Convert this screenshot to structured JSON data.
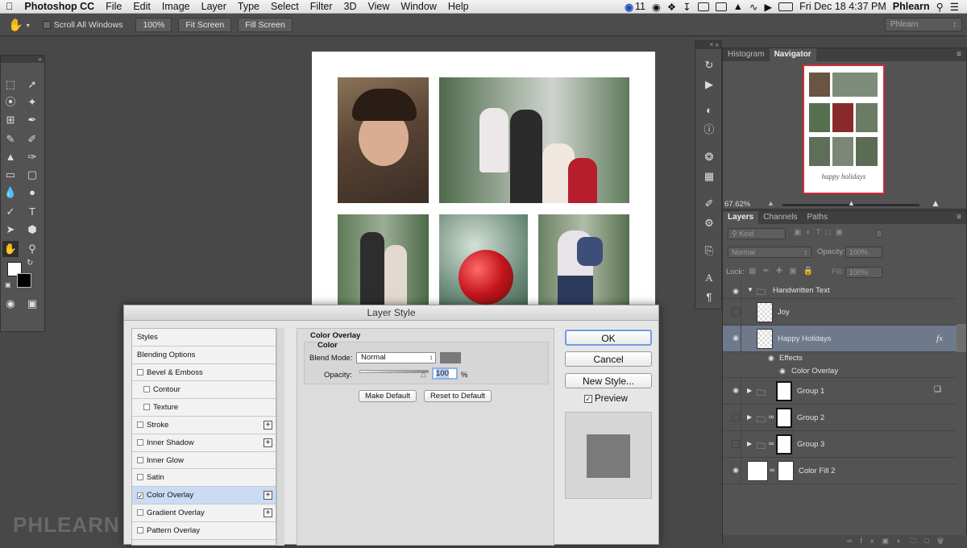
{
  "menubar": {
    "apple": "",
    "app": "Photoshop CC",
    "items": [
      "File",
      "Edit",
      "Image",
      "Layer",
      "Type",
      "Select",
      "Filter",
      "3D",
      "View",
      "Window",
      "Help"
    ],
    "badge": "11",
    "datetime": "Fri Dec 18  4:37 PM",
    "user": "Phlearn"
  },
  "options": {
    "scroll_all": "Scroll All Windows",
    "zoom100": "100%",
    "fit": "Fit Screen",
    "fill": "Fill Screen",
    "workspace": "Phlearn"
  },
  "navigator": {
    "tabs": [
      "Histogram",
      "Navigator"
    ],
    "zoom": "67.62%",
    "caption": "happy holidays"
  },
  "layers": {
    "tabs": [
      "Layers",
      "Channels",
      "Paths"
    ],
    "kind": "Kind",
    "blend": "Normal",
    "opacity_label": "Opacity:",
    "opacity": "100%",
    "lock_label": "Lock:",
    "fill_label": "Fill:",
    "fill": "100%",
    "rows": [
      {
        "name": "Handwritten Text"
      },
      {
        "name": "Joy"
      },
      {
        "name": "Happy Holidays",
        "fx": "fx"
      },
      {
        "name": "Effects"
      },
      {
        "name": "Color Overlay"
      },
      {
        "name": "Group 1"
      },
      {
        "name": "Group 2"
      },
      {
        "name": "Group 3"
      },
      {
        "name": "Color Fill 2"
      }
    ]
  },
  "dialog": {
    "title": "Layer Style",
    "styles": [
      "Styles",
      "Blending Options",
      "Bevel & Emboss",
      "Contour",
      "Texture",
      "Stroke",
      "Inner Shadow",
      "Inner Glow",
      "Satin",
      "Color Overlay",
      "Gradient Overlay",
      "Pattern Overlay"
    ],
    "section": "Color Overlay",
    "subsection": "Color",
    "blend_label": "Blend Mode:",
    "blend_value": "Normal",
    "opacity_label": "Opacity:",
    "opacity_value": "100",
    "percent": "%",
    "make_default": "Make Default",
    "reset_default": "Reset to Default",
    "ok": "OK",
    "cancel": "Cancel",
    "new_style": "New Style...",
    "preview": "Preview",
    "overlay_color": "#7a7a7a"
  },
  "watermark": "PHLEARN"
}
